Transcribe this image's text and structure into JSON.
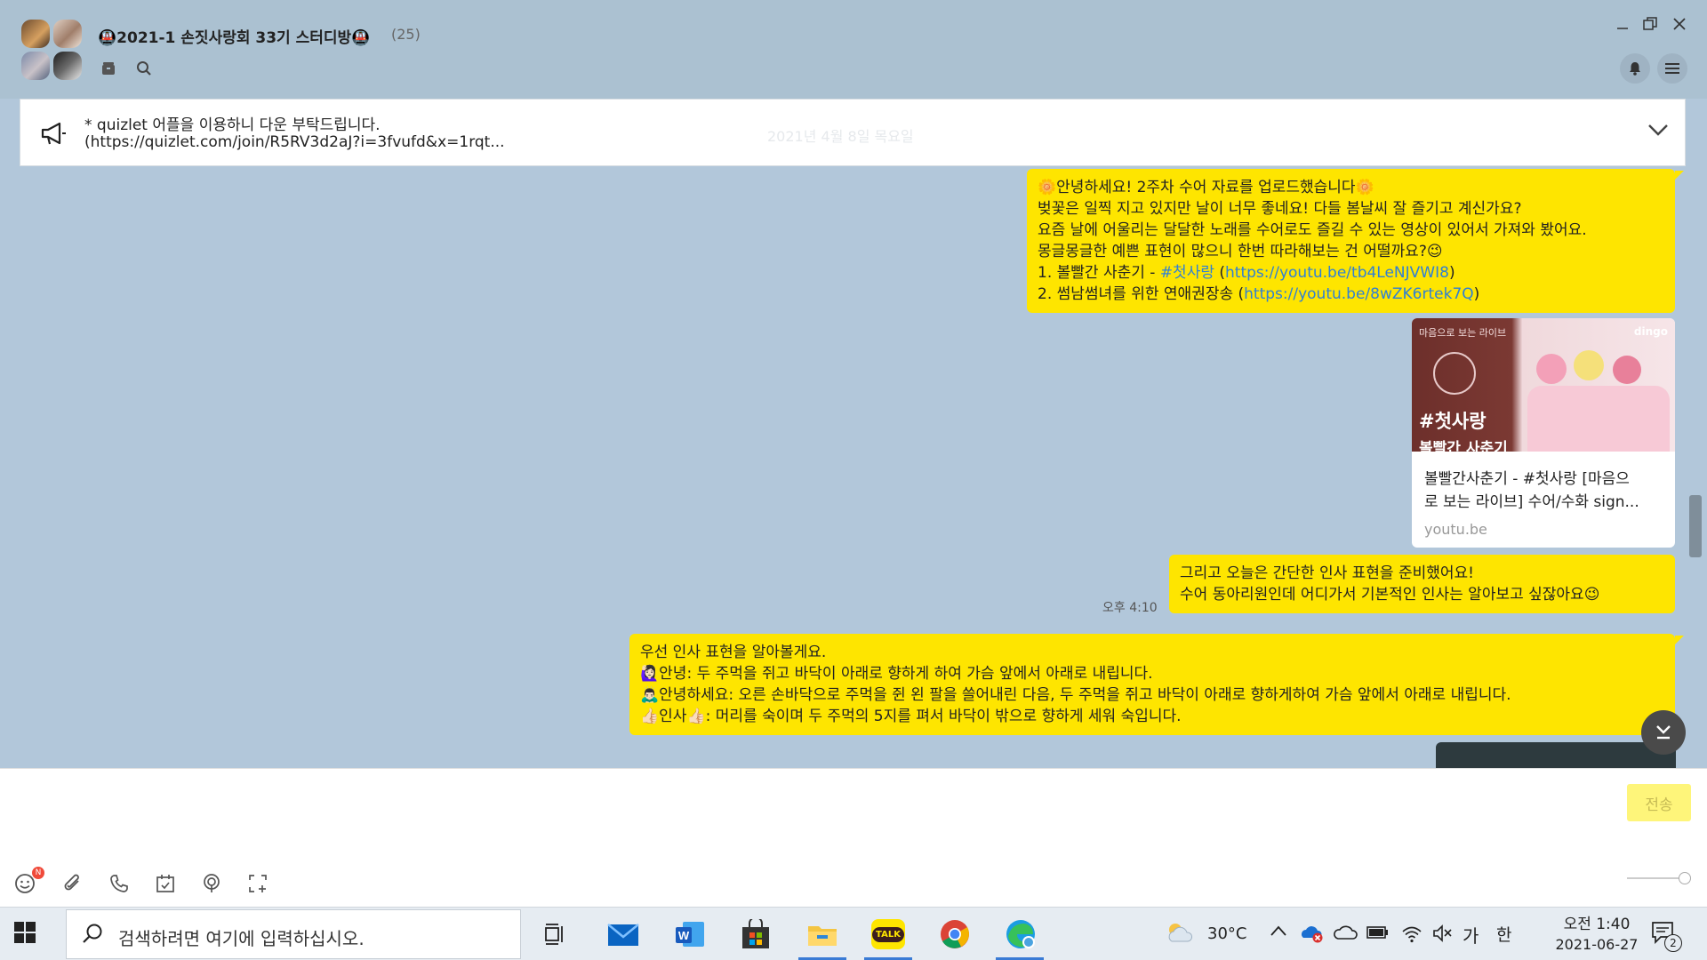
{
  "window": {
    "title": "🚇2021-1 손짓사랑회 33기 스터디방🚇",
    "member_count": "(25)"
  },
  "notice": {
    "line1": "* quizlet 어플을 이용하니 다운 부탁드립니다.",
    "line2": "(https://quizlet.com/join/R5RV3d2aJ?i=3fvufd&x=1rqt...",
    "date_overlay": "2021년 4월 8일 목요일"
  },
  "messages": {
    "m1": {
      "lines": [
        "🌼안녕하세요! 2주차 수어 자료를 업로드했습니다🌼",
        "벚꽃은 일찍 지고 있지만 날이 너무 좋네요! 다들 봄날씨 잘 즐기고 계신가요?",
        "요즘 날에 어울리는 달달한 노래를 수어로도 즐길 수 있는 영상이 있어서 가져와 봤어요.",
        "몽글몽글한 예쁜 표현이 많으니 한번 따라해보는 건 어떨까요?😉"
      ],
      "item1_prefix": "1. 볼빨간 사춘기 - ",
      "item1_tag": "#첫사랑",
      "item1_open": " (",
      "item1_link": "https://youtu.be/tb4LeNJVWI8",
      "item1_close": ")",
      "item2_prefix": "2. 썸남썸녀를 위한 연애권장송 (",
      "item2_link": "https://youtu.be/8wZK6rtek7Q",
      "item2_close": ")"
    },
    "card": {
      "thumb_tag": "#첫사랑",
      "thumb_sub": "볼빨간 사춘기",
      "thumb_corner": "마음으로 보는 라이브",
      "thumb_logo": "dingo",
      "title1": "볼빨간사춘기 - #첫사랑 [마음으",
      "title2": "로 보는 라이브] 수어/수화 sign...",
      "domain": "youtu.be"
    },
    "m2": {
      "line1": "그리고 오늘은 간단한 인사 표현을 준비했어요!",
      "line2": "수어 동아리원인데 어디가서 기본적인 인사는 알아보고 싶잖아요😉",
      "time": "오후 4:10"
    },
    "m3": {
      "line1": "우선 인사 표현을 알아볼게요.",
      "line2": "🙋🏻‍♀️안녕: 두 주먹을 쥐고 바닥이 아래로 향하게 하여 가슴 앞에서 아래로 내립니다.",
      "line3": "🙇🏻‍♂️안녕하세요: 오른 손바닥으로 주먹을 쥔 왼 팔을 쓸어내린 다음, 두 주먹을 쥐고 바닥이 아래로 향하게하여 가슴 앞에서 아래로 내립니다.",
      "line4": "👍🏻인사👍🏻: 머리를 숙이며 두 주먹의 5지를 펴서 바닥이 밖으로 향하게 세워 숙입니다."
    }
  },
  "input": {
    "send_label": "전송",
    "emoji_badge": "N"
  },
  "taskbar": {
    "search_placeholder": "검색하려면 여기에 입력하십시오.",
    "kakao_label": "TALK",
    "weather_temp": "30°C",
    "ime_lang": "가",
    "ime_mode": "한",
    "clock_time": "오전 1:40",
    "clock_date": "2021-06-27",
    "notification_count": "2"
  },
  "colors": {
    "chat_bg": "#b2c7da",
    "bubble": "#fee500",
    "link": "#2e7fd6",
    "send_disabled": "#fef57a"
  }
}
